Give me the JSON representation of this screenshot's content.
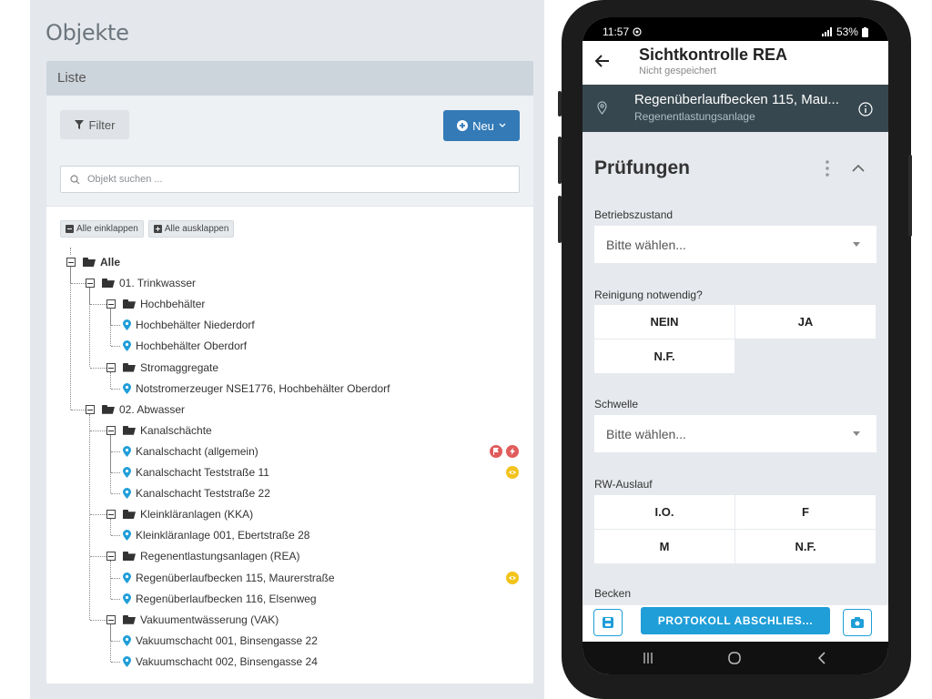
{
  "web": {
    "page_title": "Objekte",
    "card_title": "Liste",
    "filter_label": "Filter",
    "new_label": "Neu",
    "search_placeholder": "Objekt suchen ...",
    "collapse_all_label": "Alle einklappen",
    "expand_all_label": "Alle ausklappen",
    "tree": [
      {
        "label": "Alle",
        "type": "root"
      },
      {
        "label": "01. Trinkwasser",
        "type": "folder"
      },
      {
        "label": "Hochbehälter",
        "type": "folder"
      },
      {
        "label": "Hochbehälter Niederdorf",
        "type": "object"
      },
      {
        "label": "Hochbehälter Oberdorf",
        "type": "object"
      },
      {
        "label": "Stromaggregate",
        "type": "folder"
      },
      {
        "label": "Notstromerzeuger NSE1776, Hochbehälter Oberdorf",
        "type": "object"
      },
      {
        "label": "02. Abwasser",
        "type": "folder"
      },
      {
        "label": "Kanalschächte",
        "type": "folder"
      },
      {
        "label": "Kanalschacht (allgemein)",
        "type": "object",
        "badges": [
          "flag-icon",
          "bolt-icon"
        ]
      },
      {
        "label": "Kanalschacht Teststraße 11",
        "type": "object",
        "badges": [
          "eye-icon"
        ]
      },
      {
        "label": "Kanalschacht Teststraße 22",
        "type": "object"
      },
      {
        "label": "Kleinkläranlagen (KKA)",
        "type": "folder"
      },
      {
        "label": "Kleinkläranlage 001, Ebertstraße 28",
        "type": "object"
      },
      {
        "label": "Regenentlastungsanlagen (REA)",
        "type": "folder"
      },
      {
        "label": "Regenüberlaufbecken 115, Maurerstraße",
        "type": "object",
        "badges": [
          "eye-icon"
        ]
      },
      {
        "label": "Regenüberlaufbecken 116, Elsenweg",
        "type": "object"
      },
      {
        "label": "Vakuumentwässerung (VAK)",
        "type": "folder"
      },
      {
        "label": "Vakuumschacht 001, Binsengasse 22",
        "type": "object"
      },
      {
        "label": "Vakuumschacht 002, Binsengasse 24",
        "type": "object"
      }
    ],
    "colors": {
      "primary": "#337ab7",
      "pin": "#1f9ed8",
      "badge_red": "#e05c5c",
      "badge_yellow": "#f2c31b"
    }
  },
  "phone": {
    "status": {
      "time": "11:57",
      "battery": "53%"
    },
    "app_title": "Sichtkontrolle REA",
    "app_subtitle": "Nicht gespeichert",
    "object_title": "Regenüberlaufbecken 115, Mau...",
    "object_subtitle": "Regenentlastungsanlage",
    "section_title": "Prüfungen",
    "fields": {
      "betriebszustand": {
        "label": "Betriebszustand",
        "value": "Bitte wählen..."
      },
      "reinigung": {
        "label": "Reinigung notwendig?",
        "options": [
          "NEIN",
          "JA",
          "N.F."
        ]
      },
      "schwelle": {
        "label": "Schwelle",
        "value": "Bitte wählen..."
      },
      "rw_auslauf": {
        "label": "RW-Auslauf",
        "options": [
          "I.O.",
          "F",
          "M",
          "N.F."
        ]
      },
      "becken": {
        "label": "Becken"
      }
    },
    "protocol_button": "PROTOKOLL ABSCHLIES...",
    "colors": {
      "accent": "#1f9ed8",
      "infobar": "#37474f"
    }
  }
}
